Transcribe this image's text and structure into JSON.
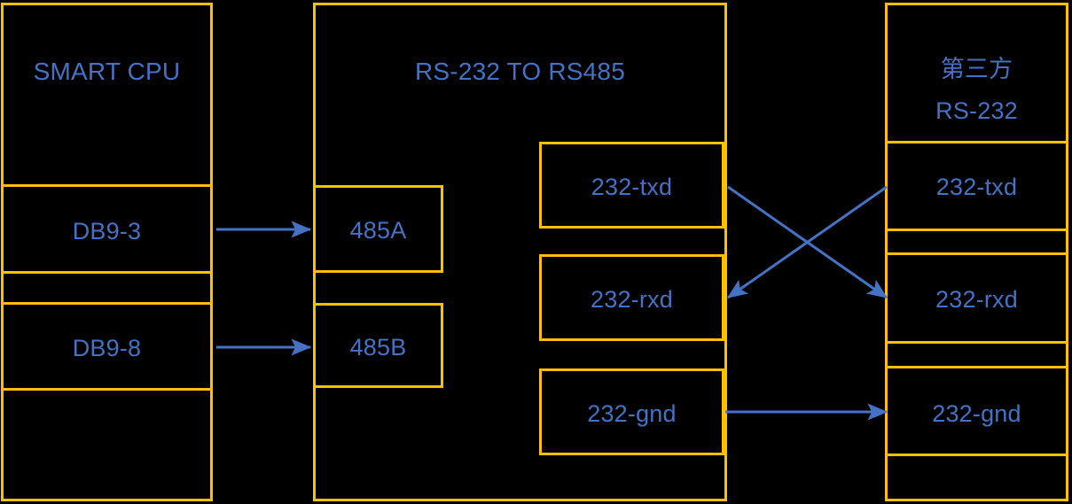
{
  "diagram": {
    "title_visible": false,
    "colors": {
      "background": "#000000",
      "box_border": "#FFC000",
      "text": "#4472C4",
      "arrow": "#4472C4"
    },
    "blocks": {
      "smart_cpu": {
        "header": "SMART CPU",
        "pins": [
          "DB9-3",
          "DB9-8"
        ]
      },
      "converter": {
        "header": "RS-232 TO RS485",
        "rs485_pins": [
          "485A",
          "485B"
        ],
        "rs232_pins": [
          "232-txd",
          "232-rxd",
          "232-gnd"
        ]
      },
      "third_party": {
        "header_line1": "第三方",
        "header_line2": "RS-232",
        "pins": [
          "232-txd",
          "232-rxd",
          "232-gnd"
        ]
      }
    },
    "connections": [
      {
        "from": "DB9-3",
        "to": "485A",
        "style": "straight-arrow"
      },
      {
        "from": "DB9-8",
        "to": "485B",
        "style": "straight-arrow"
      },
      {
        "from": "232-txd",
        "to": "232-rxd",
        "style": "cross-arrow"
      },
      {
        "from": "232-txd",
        "to": "232-rxd",
        "style": "cross-arrow-reverse"
      },
      {
        "from": "232-gnd",
        "to": "232-gnd",
        "style": "straight-arrow"
      }
    ]
  }
}
